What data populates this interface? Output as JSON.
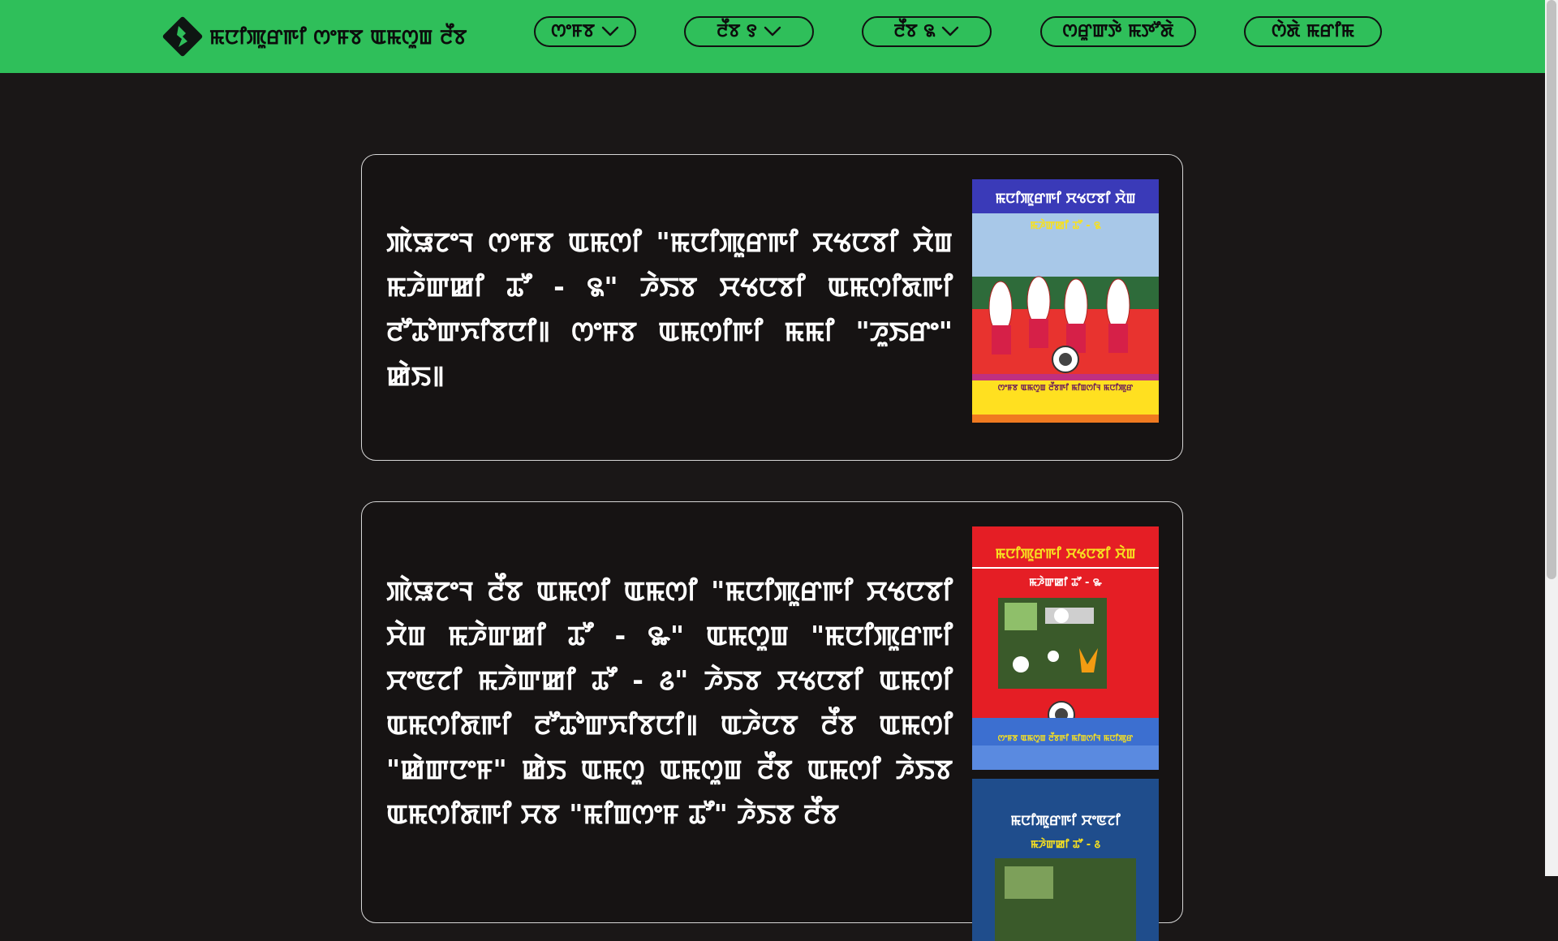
{
  "navbar": {
    "brand_title": "ꯃꯅꯤꯄꯨꯔꯒꯤ ꯁꯦꯝꯕ ꯑꯃꯁꯨꯡ ꯂꯩꯕ",
    "bg_color": "#2fbf5a",
    "items": [
      {
        "label": "ꯁꯦꯝꯕ",
        "has_dropdown": true,
        "icon": "chevron-down-icon"
      },
      {
        "label": "ꯂꯩꯕ ꯱",
        "has_dropdown": true,
        "icon": "chevron-down-icon"
      },
      {
        "label": "ꯂꯩꯕ ꯲",
        "has_dropdown": true,
        "icon": "chevron-down-icon"
      },
      {
        "label": "ꯁꯔꯨꯛꯇꯥ ꯃꯇꯧꯗꯥ",
        "has_dropdown": false
      },
      {
        "label": "ꯁꯥꯗꯥ ꯃꯔꯤꯃ",
        "has_dropdown": false
      }
    ]
  },
  "cards": [
    {
      "text": "ꯄꯥꯎꯖꯦꯜ ꯁꯦꯝꯕ ꯑꯃꯁꯤ \"ꯃꯅꯤꯄꯨꯔꯒꯤ ꯆꯠꯅꯕꯤ ꯆꯥꯡ ꯃꯍꯥꯛꯀꯤ ꯊꯧ - ꯲\" ꯍꯥꯏꯕ ꯆꯠꯅꯕꯤ ꯑꯃꯁꯤꯗꯒꯤ ꯂꯧꯊꯣꯛꯈꯤꯕꯅꯤ꯫ ꯁꯦꯝꯕ ꯑꯃꯁꯤꯒꯤ ꯃꯃꯤ \"ꯍꯨꯏꯔꯦ\" ꯀꯥꯏ꯫",
      "cover": {
        "title": "ꯃꯅꯤꯄꯨꯔꯒꯤ ꯆꯠꯅꯕꯤ ꯆꯥꯡ",
        "subtitle": "ꯃꯍꯥꯛꯀꯤ ꯊꯧ - ꯲",
        "footer": "ꯁꯦꯝꯕ ꯑꯃꯁꯨꯡ ꯂꯩꯕꯒꯤ ꯃꯤꯡꯁꯤꯜ ꯃꯅꯤꯄꯨꯔ",
        "colors": {
          "band": "#3a3ab8",
          "stage": "#e8332f",
          "footer": "#f7e020"
        }
      }
    },
    {
      "text": "ꯄꯥꯎꯖꯦꯜ ꯂꯩꯕ ꯑꯃꯁꯤ ꯑꯃꯁꯤ \"ꯃꯅꯤꯄꯨꯔꯒꯤ ꯆꯠꯅꯕꯤ ꯆꯥꯡ ꯃꯍꯥꯛꯀꯤ ꯊꯧ - ꯳\" ꯑꯃꯁꯨꯡ \"ꯃꯅꯤꯄꯨꯔꯒꯤ ꯆꯦꯟꯖꯤ ꯃꯍꯥꯛꯀꯤ ꯊꯧ - ꯴\" ꯍꯥꯏꯕ ꯆꯠꯅꯕꯤ ꯑꯃꯁꯤ ꯑꯃꯁꯤꯗꯒꯤ ꯂꯧꯊꯣꯛꯈꯤꯕꯅꯤ꯫ ꯑꯍꯥꯅꯕ ꯂꯩꯕ ꯑꯃꯁꯤ \"ꯀꯥꯛꯅꯦꯝ\" ꯀꯥꯏ ꯑꯃꯁꯨ ꯑꯃꯁꯨꯡ ꯂꯩꯕ ꯑꯃꯁꯤ ꯍꯥꯏꯕ ꯑꯃꯁꯤꯗꯒꯤ ꯆꯕ \"ꯃꯤꯡꯁꯦꯝ ꯊꯧ\" ꯍꯥꯏꯕ ꯂꯩꯕ",
      "cover": {
        "title": "ꯃꯅꯤꯄꯨꯔꯒꯤ ꯆꯠꯅꯕꯤ ꯆꯥꯡ",
        "subtitle": "ꯃꯍꯥꯛꯀꯤ ꯊꯧ - ꯳",
        "footer": "ꯁꯦꯝꯕ ꯑꯃꯁꯨꯡ ꯂꯩꯕꯒꯤ ꯃꯤꯡꯁꯤꯜ ꯃꯅꯤꯄꯨꯔ",
        "colors": {
          "top": "#e51e25",
          "bottom": "#3c6fd0"
        }
      },
      "cover2": {
        "title": "ꯃꯅꯤꯄꯨꯔꯒꯤ ꯆꯦꯟꯖꯤ",
        "subtitle": "ꯃꯍꯥꯛꯀꯤ ꯊꯧ - ꯴",
        "colors": {
          "bg": "#1f4d8c",
          "subtitle": "#f7e020"
        }
      }
    }
  ]
}
